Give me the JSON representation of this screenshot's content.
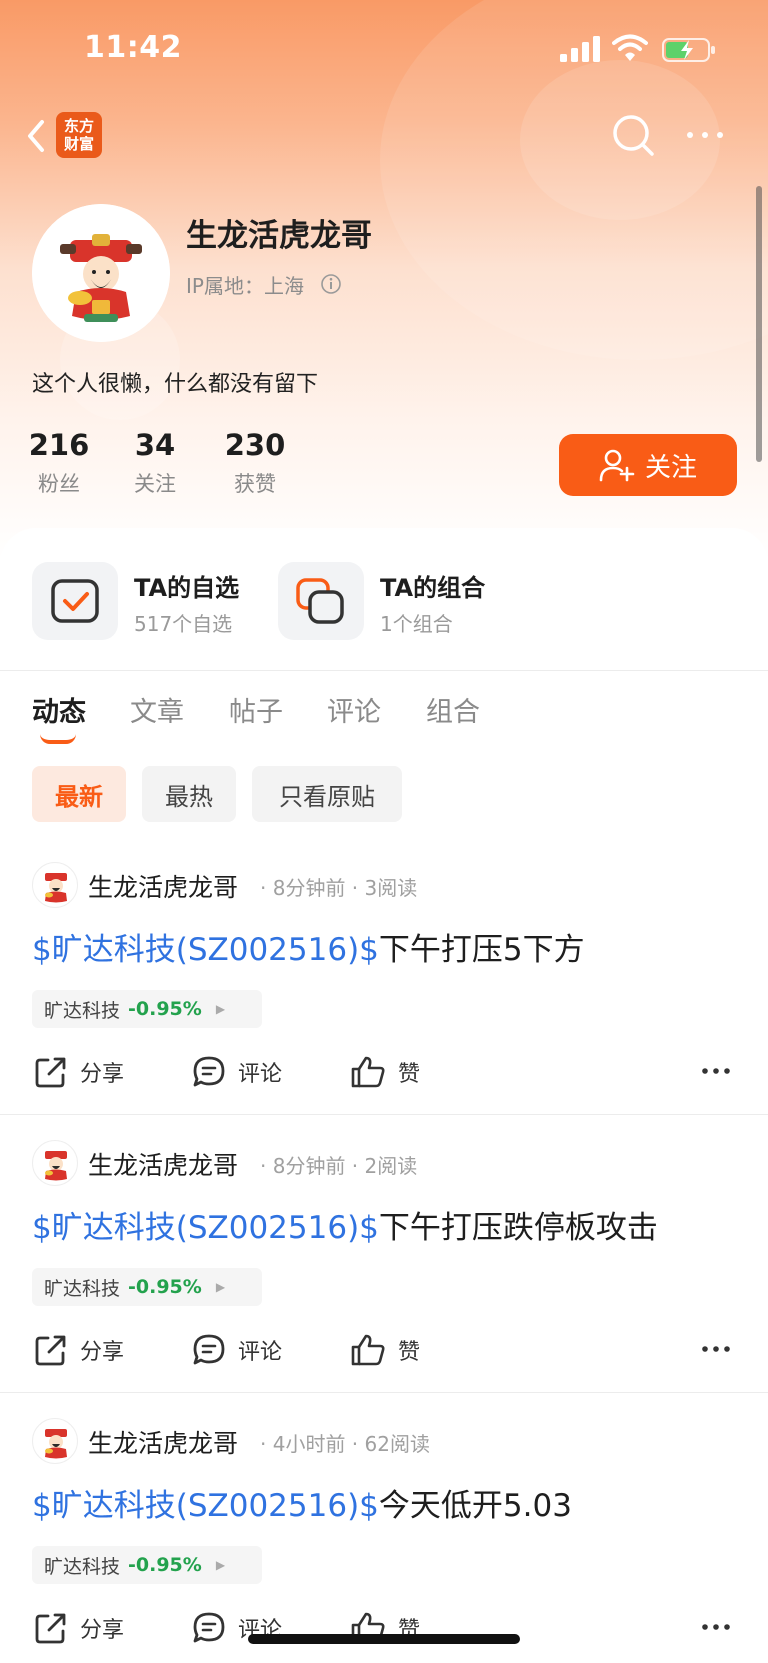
{
  "status_bar": {
    "time": "11:42"
  },
  "nav": {
    "logo_line1": "东方",
    "logo_line2": "财富"
  },
  "profile": {
    "name": "生龙活虎龙哥",
    "ip_location": "IP属地：上海",
    "bio": "这个人很懒，什么都没有留下",
    "stats": [
      {
        "value": "216",
        "label": "粉丝"
      },
      {
        "value": "34",
        "label": "关注"
      },
      {
        "value": "230",
        "label": "获赞"
      }
    ],
    "follow_label": "关注"
  },
  "quick_links": [
    {
      "title": "TA的自选",
      "subtitle": "517个自选",
      "icon": "checkbox-icon"
    },
    {
      "title": "TA的组合",
      "subtitle": "1个组合",
      "icon": "overlap-squares-icon"
    }
  ],
  "tabs": [
    "动态",
    "文章",
    "帖子",
    "评论",
    "组合"
  ],
  "active_tab": "动态",
  "filters": [
    "最新",
    "最热",
    "只看原贴"
  ],
  "active_filter": "最新",
  "posts": [
    {
      "author": "生龙活虎龙哥",
      "meta": "· 8分钟前 · 3阅读",
      "stock": "$旷达科技(SZ002516)$",
      "text": "下午打压5下方",
      "tag_name": "旷达科技",
      "tag_change": "-0.95%"
    },
    {
      "author": "生龙活虎龙哥",
      "meta": "· 8分钟前 · 2阅读",
      "stock": "$旷达科技(SZ002516)$",
      "text": "下午打压跌停板攻击",
      "tag_name": "旷达科技",
      "tag_change": "-0.95%"
    },
    {
      "author": "生龙活虎龙哥",
      "meta": "· 4小时前 · 62阅读",
      "stock": "$旷达科技(SZ002516)$",
      "text": "今天低开5.03",
      "tag_name": "旷达科技",
      "tag_change": "-0.95%"
    }
  ],
  "actions": {
    "share": "分享",
    "comment": "评论",
    "like": "赞"
  },
  "colors": {
    "accent": "#f95c16",
    "link": "#2f72e0",
    "down": "#23a24d"
  }
}
